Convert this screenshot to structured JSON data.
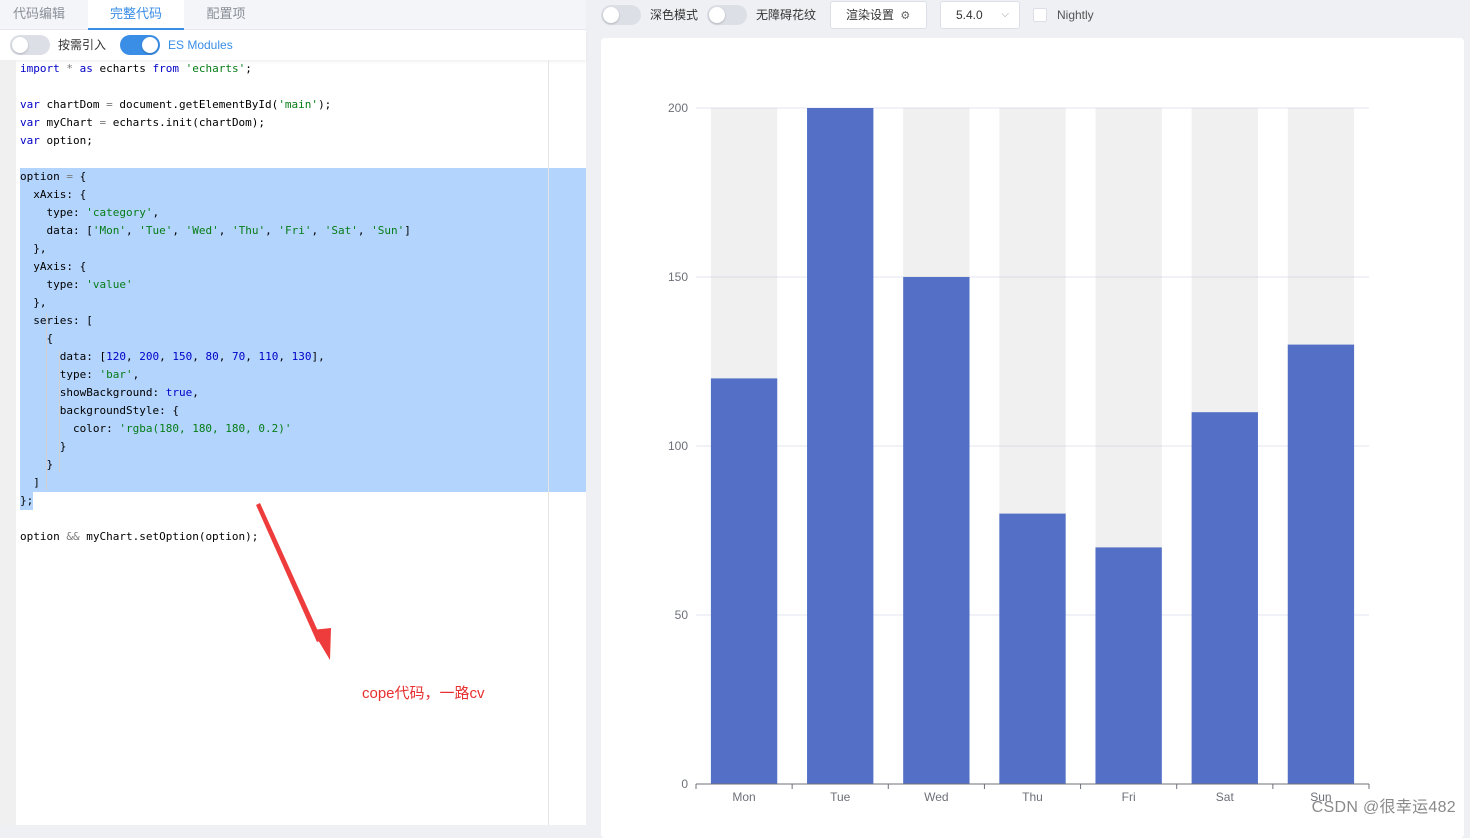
{
  "tabs": [
    {
      "label": "代码编辑",
      "active": false
    },
    {
      "label": "完整代码",
      "active": true
    },
    {
      "label": "配置项",
      "active": false
    }
  ],
  "editor_toolbar": {
    "on_demand_label": "按需引入",
    "on_demand_on": false,
    "es_modules_label": "ES Modules",
    "es_modules_on": true
  },
  "code_lines": [
    "import * as echarts from 'echarts';",
    "",
    "var chartDom = document.getElementById('main');",
    "var myChart = echarts.init(chartDom);",
    "var option;",
    "",
    "option = {",
    "  xAxis: {",
    "    type: 'category',",
    "    data: ['Mon', 'Tue', 'Wed', 'Thu', 'Fri', 'Sat', 'Sun']",
    "  },",
    "  yAxis: {",
    "    type: 'value'",
    "  },",
    "  series: [",
    "    {",
    "      data: [120, 200, 150, 80, 70, 110, 130],",
    "      type: 'bar',",
    "      showBackground: true,",
    "      backgroundStyle: {",
    "        color: 'rgba(180, 180, 180, 0.2)'",
    "      }",
    "    }",
    "  ]",
    "};",
    "",
    "option && myChart.setOption(option);"
  ],
  "annotation": {
    "text": "cope代码，一路cv",
    "color": "#e8302f"
  },
  "preview_toolbar": {
    "dark_mode_label": "深色模式",
    "dark_mode_on": false,
    "accessibility_label": "无障碍花纹",
    "accessibility_on": false,
    "render_settings_label": "渲染设置",
    "version": "5.4.0",
    "nightly_label": "Nightly",
    "nightly_checked": false
  },
  "chart_data": {
    "type": "bar",
    "categories": [
      "Mon",
      "Tue",
      "Wed",
      "Thu",
      "Fri",
      "Sat",
      "Sun"
    ],
    "values": [
      120,
      200,
      150,
      80,
      70,
      110,
      130
    ],
    "ylim": [
      0,
      200
    ],
    "yticks": [
      0,
      50,
      100,
      150,
      200
    ],
    "bar_color": "#5470c6",
    "background_color": "rgba(180, 180, 180, 0.2)",
    "show_background": true,
    "grid": true,
    "title": "",
    "xlabel": "",
    "ylabel": ""
  },
  "watermark": "CSDN @很幸运482",
  "colors": {
    "accent": "#3a8ee6",
    "selection": "#b3d4fd"
  }
}
